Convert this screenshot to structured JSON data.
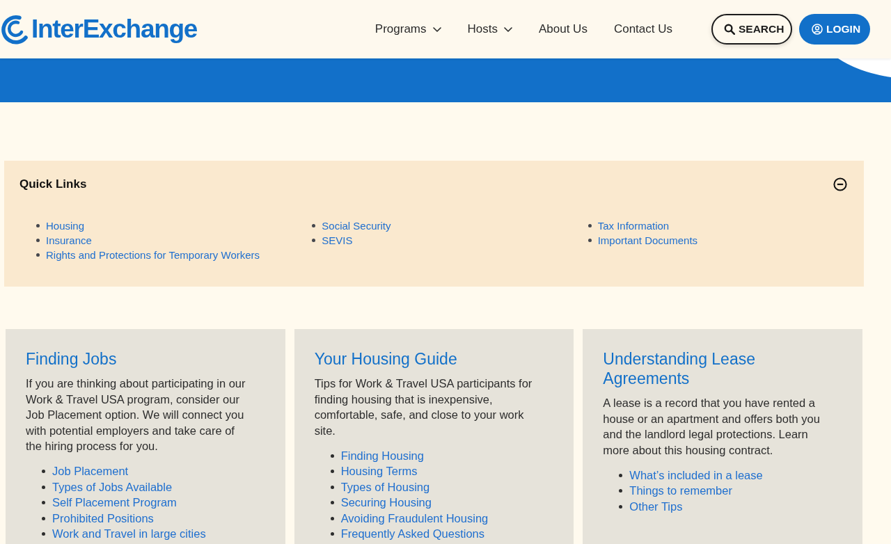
{
  "header": {
    "logo": "InterExchange",
    "nav": [
      {
        "label": "Programs",
        "kind": "dropdown"
      },
      {
        "label": "Hosts",
        "kind": "dropdown"
      },
      {
        "label": "About Us",
        "kind": "link"
      },
      {
        "label": "Contact Us",
        "kind": "link"
      }
    ],
    "actions": [
      {
        "label": "SEARCH",
        "kind": "search"
      },
      {
        "label": "LOGIN",
        "kind": "login"
      }
    ]
  },
  "quick_links": {
    "title": "Quick Links",
    "expanded": true,
    "columns": [
      [
        "Housing",
        "Insurance",
        "Rights and Protections for Temporary Workers"
      ],
      [
        "Social Security",
        "SEVIS"
      ],
      [
        "Tax Information",
        "Important Documents"
      ]
    ]
  },
  "cards": [
    {
      "title": "Finding Jobs",
      "description": "If you are thinking about participating in our Work & Travel USA program, consider our Job Placement option. We will connect you with potential employers and take care of the hiring process for you.",
      "links": [
        "Job Placement",
        "Types of Jobs Available",
        "Self Placement Program",
        "Prohibited Positions",
        "Work and Travel in large cities"
      ]
    },
    {
      "title": "Your Housing Guide",
      "description": "Tips for Work & Travel USA participants for finding housing that is inexpensive, comfortable, safe, and close to your work site.",
      "links": [
        "Finding Housing",
        "Housing Terms",
        "Types of Housing",
        "Securing Housing",
        "Avoiding Fraudulent Housing",
        "Frequently Asked Questions"
      ]
    },
    {
      "title": "Understanding Lease Agreements",
      "description": "A lease is a record that you have rented a house or an apartment and offers both you and the landlord legal protections. Learn more about this housing contract.",
      "links": [
        "What’s included in a lease",
        "Things to remember",
        "Other Tips"
      ]
    }
  ]
}
